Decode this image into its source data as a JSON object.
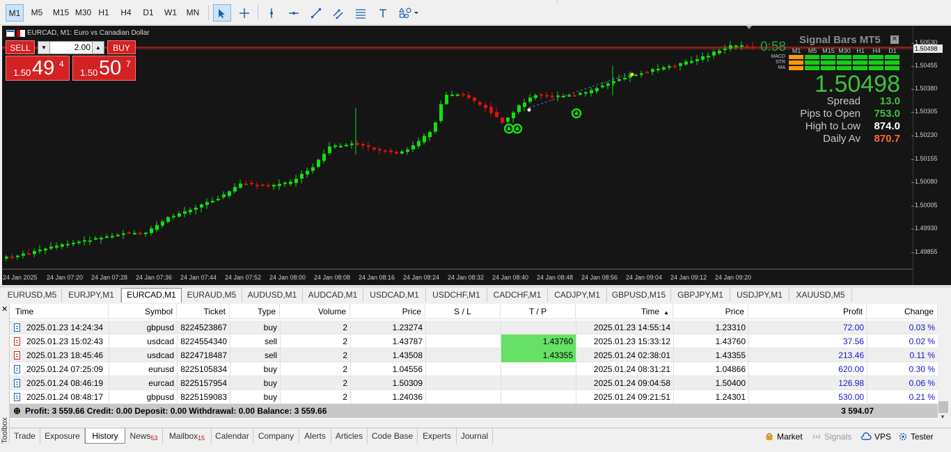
{
  "toolbar": {
    "timeframes": [
      "M1",
      "M5",
      "M15",
      "M30",
      "H1",
      "H4",
      "D1",
      "W1",
      "MN"
    ],
    "active_timeframe": "M1"
  },
  "chart": {
    "title": "EURCAD, M1:  Euro vs Canadian Dollar",
    "sell_label": "SELL",
    "buy_label": "BUY",
    "lot": "2.00",
    "sell_price_prefix": "1.50",
    "sell_price_big": "49",
    "sell_price_sup": "4",
    "buy_price_prefix": "1.50",
    "buy_price_big": "50",
    "buy_price_sup": "7",
    "current_price_label": "1.50498",
    "price_scale": [
      "1.50530",
      "1.50455",
      "1.50380",
      "1.50305",
      "1.50230",
      "1.50155",
      "1.50080",
      "1.50005",
      "1.49930",
      "1.49855"
    ],
    "time_labels": [
      "24 Jan 2025",
      "24 Jan 07:20",
      "24 Jan 07:28",
      "24 Jan 07:36",
      "24 Jan 07:44",
      "24 Jan 07:52",
      "24 Jan 08:00",
      "24 Jan 08:08",
      "24 Jan 08:16",
      "24 Jan 08:24",
      "24 Jan 08:32",
      "24 Jan 08:40",
      "24 Jan 08:48",
      "24 Jan 08:56",
      "24 Jan 09:04",
      "24 Jan 09:12",
      "24 Jan 09:20"
    ]
  },
  "signal_bars": {
    "title": "Signal Bars MT5",
    "timer": "0:58",
    "timeframes": [
      "M1",
      "M5",
      "M15",
      "M30",
      "H1",
      "H4",
      "D1"
    ],
    "rows": [
      "MACD",
      "STR",
      "MA"
    ],
    "big_price": "1.50498",
    "stats": [
      {
        "label": "Spread",
        "value": "13.0",
        "color": "#3fbf3f"
      },
      {
        "label": "Pips to Open",
        "value": "753.0",
        "color": "#3fbf3f"
      },
      {
        "label": "High to Low",
        "value": "874.0",
        "color": "#ffffff"
      },
      {
        "label": "Daily Av",
        "value": "870.7",
        "color": "#ff6a3a"
      }
    ]
  },
  "symbol_tabs": [
    "EURUSD,M5",
    "EURJPY,M1",
    "EURCAD,M1",
    "EURAUD,M5",
    "AUDUSD,M1",
    "AUDCAD,M1",
    "USDCAD,M1",
    "USDCHF,M1",
    "CADCHF,M1",
    "CADJPY,M1",
    "GBPUSD,M15",
    "GBPJPY,M1",
    "USDJPY,M1",
    "XAUUSD,M5"
  ],
  "active_symbol_tab": "EURCAD,M1",
  "history": {
    "headers": [
      "Time",
      "Symbol",
      "Ticket",
      "Type",
      "Volume",
      "Price",
      "S / L",
      "T / P",
      "Time",
      "Price",
      "Profit",
      "Change"
    ],
    "rows": [
      {
        "time": "2025.01.23 14:24:34",
        "symbol": "gbpusd",
        "ticket": "8224523867",
        "type": "buy",
        "volume": "2",
        "price": "1.23274",
        "sl": "",
        "tp": "",
        "time2": "2025.01.23 14:55:14",
        "price2": "1.23310",
        "profit": "72.00",
        "change": "0.03 %"
      },
      {
        "time": "2025.01.23 15:02:43",
        "symbol": "usdcad",
        "ticket": "8224554340",
        "type": "sell",
        "volume": "2",
        "price": "1.43787",
        "sl": "",
        "tp": "1.43760",
        "time2": "2025.01.23 15:33:12",
        "price2": "1.43760",
        "profit": "37.56",
        "change": "0.02 %"
      },
      {
        "time": "2025.01.23 18:45:46",
        "symbol": "usdcad",
        "ticket": "8224718487",
        "type": "sell",
        "volume": "2",
        "price": "1.43508",
        "sl": "",
        "tp": "1.43355",
        "time2": "2025.01.24 02:38:01",
        "price2": "1.43355",
        "profit": "213.46",
        "change": "0.11 %"
      },
      {
        "time": "2025.01.24 07:25:09",
        "symbol": "eurusd",
        "ticket": "8225105834",
        "type": "buy",
        "volume": "2",
        "price": "1.04556",
        "sl": "",
        "tp": "",
        "time2": "2025.01.24 08:31:21",
        "price2": "1.04866",
        "profit": "620.00",
        "change": "0.30 %"
      },
      {
        "time": "2025.01.24 08:46:19",
        "symbol": "eurcad",
        "ticket": "8225157954",
        "type": "buy",
        "volume": "2",
        "price": "1.50309",
        "sl": "",
        "tp": "",
        "time2": "2025.01.24 09:04:58",
        "price2": "1.50400",
        "profit": "126.98",
        "change": "0.06 %"
      },
      {
        "time": "2025.01.24 08:48:17",
        "symbol": "gbpusd",
        "ticket": "8225159083",
        "type": "buy",
        "volume": "2",
        "price": "1.24036",
        "sl": "",
        "tp": "",
        "time2": "2025.01.24 09:21:51",
        "price2": "1.24301",
        "profit": "530.00",
        "change": "0.21 %"
      }
    ],
    "summary": "Profit: 3 559.66  Credit: 0.00  Deposit: 0.00  Withdrawal: 0.00  Balance: 3 559.66",
    "summary_total": "3 594.07"
  },
  "bottom_tabs": [
    {
      "label": "Trade",
      "badge": ""
    },
    {
      "label": "Exposure",
      "badge": ""
    },
    {
      "label": "History",
      "badge": ""
    },
    {
      "label": "News",
      "badge": "53"
    },
    {
      "label": "Mailbox",
      "badge": "15"
    },
    {
      "label": "Calendar",
      "badge": ""
    },
    {
      "label": "Company",
      "badge": ""
    },
    {
      "label": "Alerts",
      "badge": ""
    },
    {
      "label": "Articles",
      "badge": ""
    },
    {
      "label": "Code Base",
      "badge": ""
    },
    {
      "label": "Experts",
      "badge": ""
    },
    {
      "label": "Journal",
      "badge": ""
    }
  ],
  "active_bottom_tab": "History",
  "right_tabs": [
    "Market",
    "Signals",
    "VPS",
    "Tester"
  ],
  "toolbox_label": "Toolbox"
}
